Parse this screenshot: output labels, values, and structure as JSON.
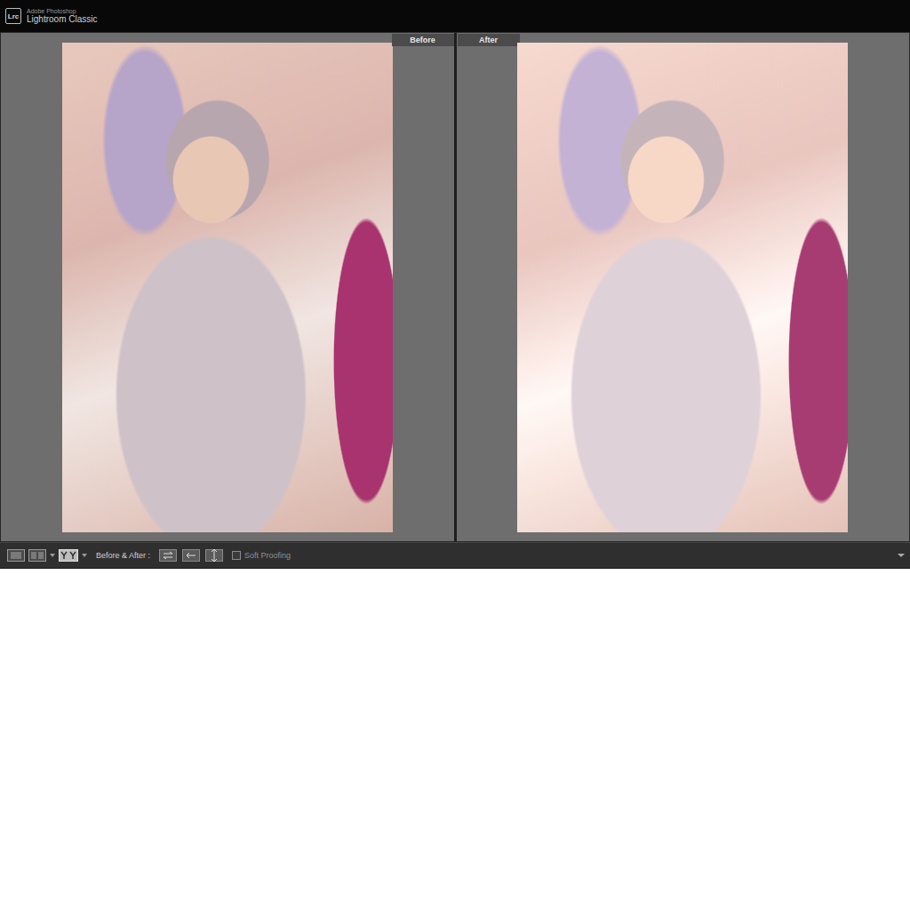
{
  "window": {
    "app_vendor": "Adobe Photoshop",
    "title": "Lightroom Classic",
    "logo": "Lrc"
  },
  "panes": [
    {
      "label": "Before"
    },
    {
      "label": "After"
    }
  ],
  "toolbar": {
    "compare_label": "Before & After :",
    "soft_proofing": {
      "label": "Soft Proofing",
      "checked": false
    }
  }
}
